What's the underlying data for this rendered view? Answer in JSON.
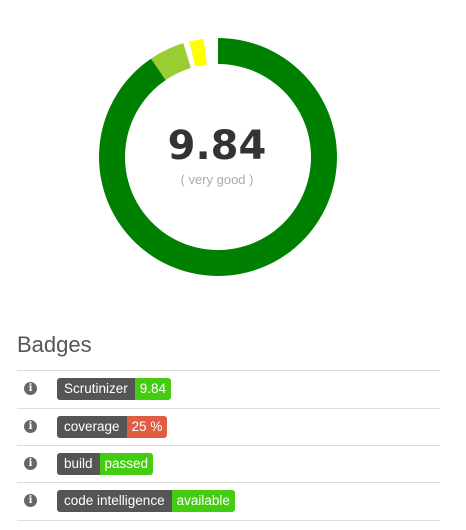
{
  "score": {
    "value": "9.84",
    "rating": "( very good )",
    "chart_data": {
      "type": "pie",
      "segments": [
        {
          "fraction": 0.905,
          "color": "#008000"
        },
        {
          "fraction": 0.048,
          "color": "#9ACD32"
        },
        {
          "fraction": 0.008,
          "color": "#ffffff"
        },
        {
          "fraction": 0.02,
          "color": "#ffff00"
        },
        {
          "fraction": 0.019,
          "color": "#ffffff"
        }
      ]
    }
  },
  "badges": {
    "title": "Badges",
    "items": [
      {
        "label": "Scrutinizer",
        "value": "9.84",
        "color": "#44cc11",
        "icon": "info-icon"
      },
      {
        "label": "coverage",
        "value": "25 %",
        "color": "#e05d44",
        "icon": "info-icon"
      },
      {
        "label": "build",
        "value": "passed",
        "color": "#44cc11",
        "icon": "info-icon"
      },
      {
        "label": "code intelligence",
        "value": "available",
        "color": "#44cc11",
        "icon": "info-icon"
      }
    ]
  }
}
